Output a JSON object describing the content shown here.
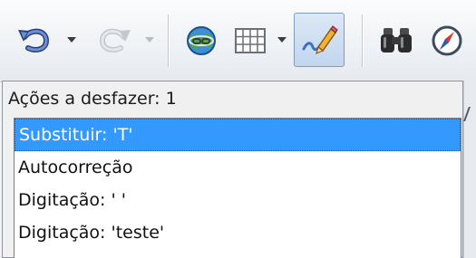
{
  "toolbar": {
    "buttons": [
      {
        "name": "undo",
        "icon": "undo-icon",
        "enabled": true
      },
      {
        "name": "redo",
        "icon": "redo-icon",
        "enabled": false
      },
      {
        "name": "hyperlink",
        "icon": "globe-link-icon",
        "enabled": true
      },
      {
        "name": "table",
        "icon": "table-grid-icon",
        "enabled": true
      },
      {
        "name": "show-draw-functions",
        "icon": "draw-pencil-icon",
        "enabled": true,
        "pressed": true
      },
      {
        "name": "find-replace",
        "icon": "binoculars-icon",
        "enabled": true
      },
      {
        "name": "navigator",
        "icon": "compass-icon",
        "enabled": true
      }
    ]
  },
  "undo_panel": {
    "header": "Ações a desfazer: 1",
    "items": [
      {
        "label": "Substituir: 'T'",
        "selected": true
      },
      {
        "label": "Autocorreção",
        "selected": false
      },
      {
        "label": "Digitação: ' '",
        "selected": false
      },
      {
        "label": "Digitação: 'teste'",
        "selected": false
      }
    ]
  },
  "colors": {
    "selection": "#3399ff",
    "toolbar_bg": "#eef1f5",
    "panel_bg": "#f0f0f0"
  }
}
